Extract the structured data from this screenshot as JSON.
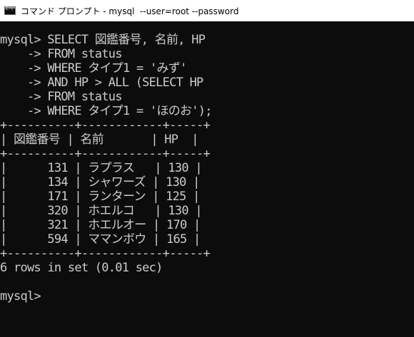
{
  "window": {
    "title": "コマンド プロンプト - mysql  --user=root --password"
  },
  "console": {
    "lines": [
      "mysql> SELECT 図鑑番号, 名前, HP",
      "    -> FROM status",
      "    -> WHERE タイプ1 = 'みず'",
      "    -> AND HP > ALL (SELECT HP",
      "    -> FROM status",
      "    -> WHERE タイプ1 = 'ほのお');",
      "+----------+------------+-----+",
      "| 図鑑番号 | 名前       | HP  |",
      "+----------+------------+-----+",
      "|      131 | ラプラス   | 130 |",
      "|      134 | シャワーズ | 130 |",
      "|      171 | ランターン | 125 |",
      "|      320 | ホエルコ   | 130 |",
      "|      321 | ホエルオー | 170 |",
      "|      594 | ママンボウ | 165 |",
      "+----------+------------+-----+",
      "6 rows in set (0.01 sec)",
      "",
      "mysql>"
    ]
  },
  "colors": {
    "console_background": "#0c0c0c",
    "console_text": "#cccccc",
    "titlebar_background": "#ffffff"
  },
  "icons": {
    "app": "command-prompt-icon"
  }
}
